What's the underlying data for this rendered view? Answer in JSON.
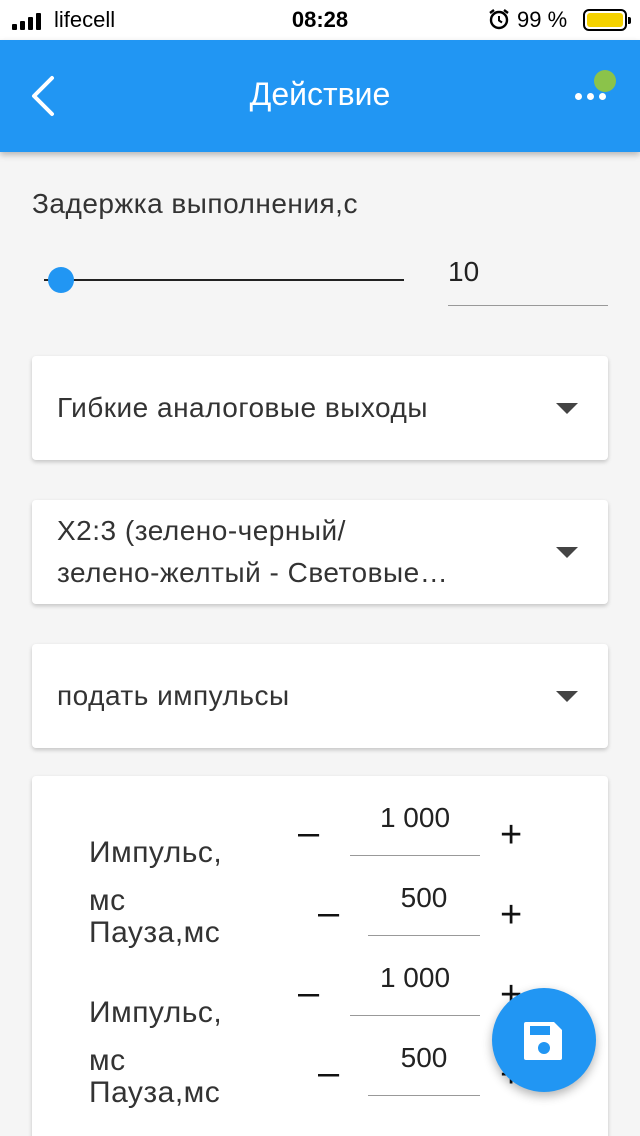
{
  "status_bar": {
    "carrier": "lifecell",
    "time": "08:28",
    "battery_percent": "99 %",
    "battery_color": "#f5d200"
  },
  "app_bar": {
    "title": "Действие",
    "back_icon": "chevron-left-icon",
    "more_icon": "more-horizontal-icon",
    "status_dot_color": "#8bc34a",
    "color": "#2196f3"
  },
  "delay": {
    "label": "Задержка выполнения,с",
    "value": "10",
    "slider_fraction": 0.0
  },
  "dropdowns": [
    {
      "lines": [
        "Гибкие аналоговые выходы"
      ]
    },
    {
      "lines": [
        "X2:3 (зелено-черный/",
        "зелено-желтый - Световые…"
      ]
    },
    {
      "lines": [
        "подать импульсы"
      ]
    }
  ],
  "pulses": [
    {
      "label_1": "Импульс,",
      "label_2": "мс",
      "value": "1 000"
    },
    {
      "label_1": "Пауза,мс",
      "value": "500"
    },
    {
      "label_1": "Импульс,",
      "label_2": "мс",
      "value": "1 000"
    },
    {
      "label_1": "Пауза,мс",
      "value": "500"
    }
  ],
  "controls": {
    "minus": "–",
    "plus": "+"
  },
  "fab": {
    "icon": "save-icon"
  }
}
